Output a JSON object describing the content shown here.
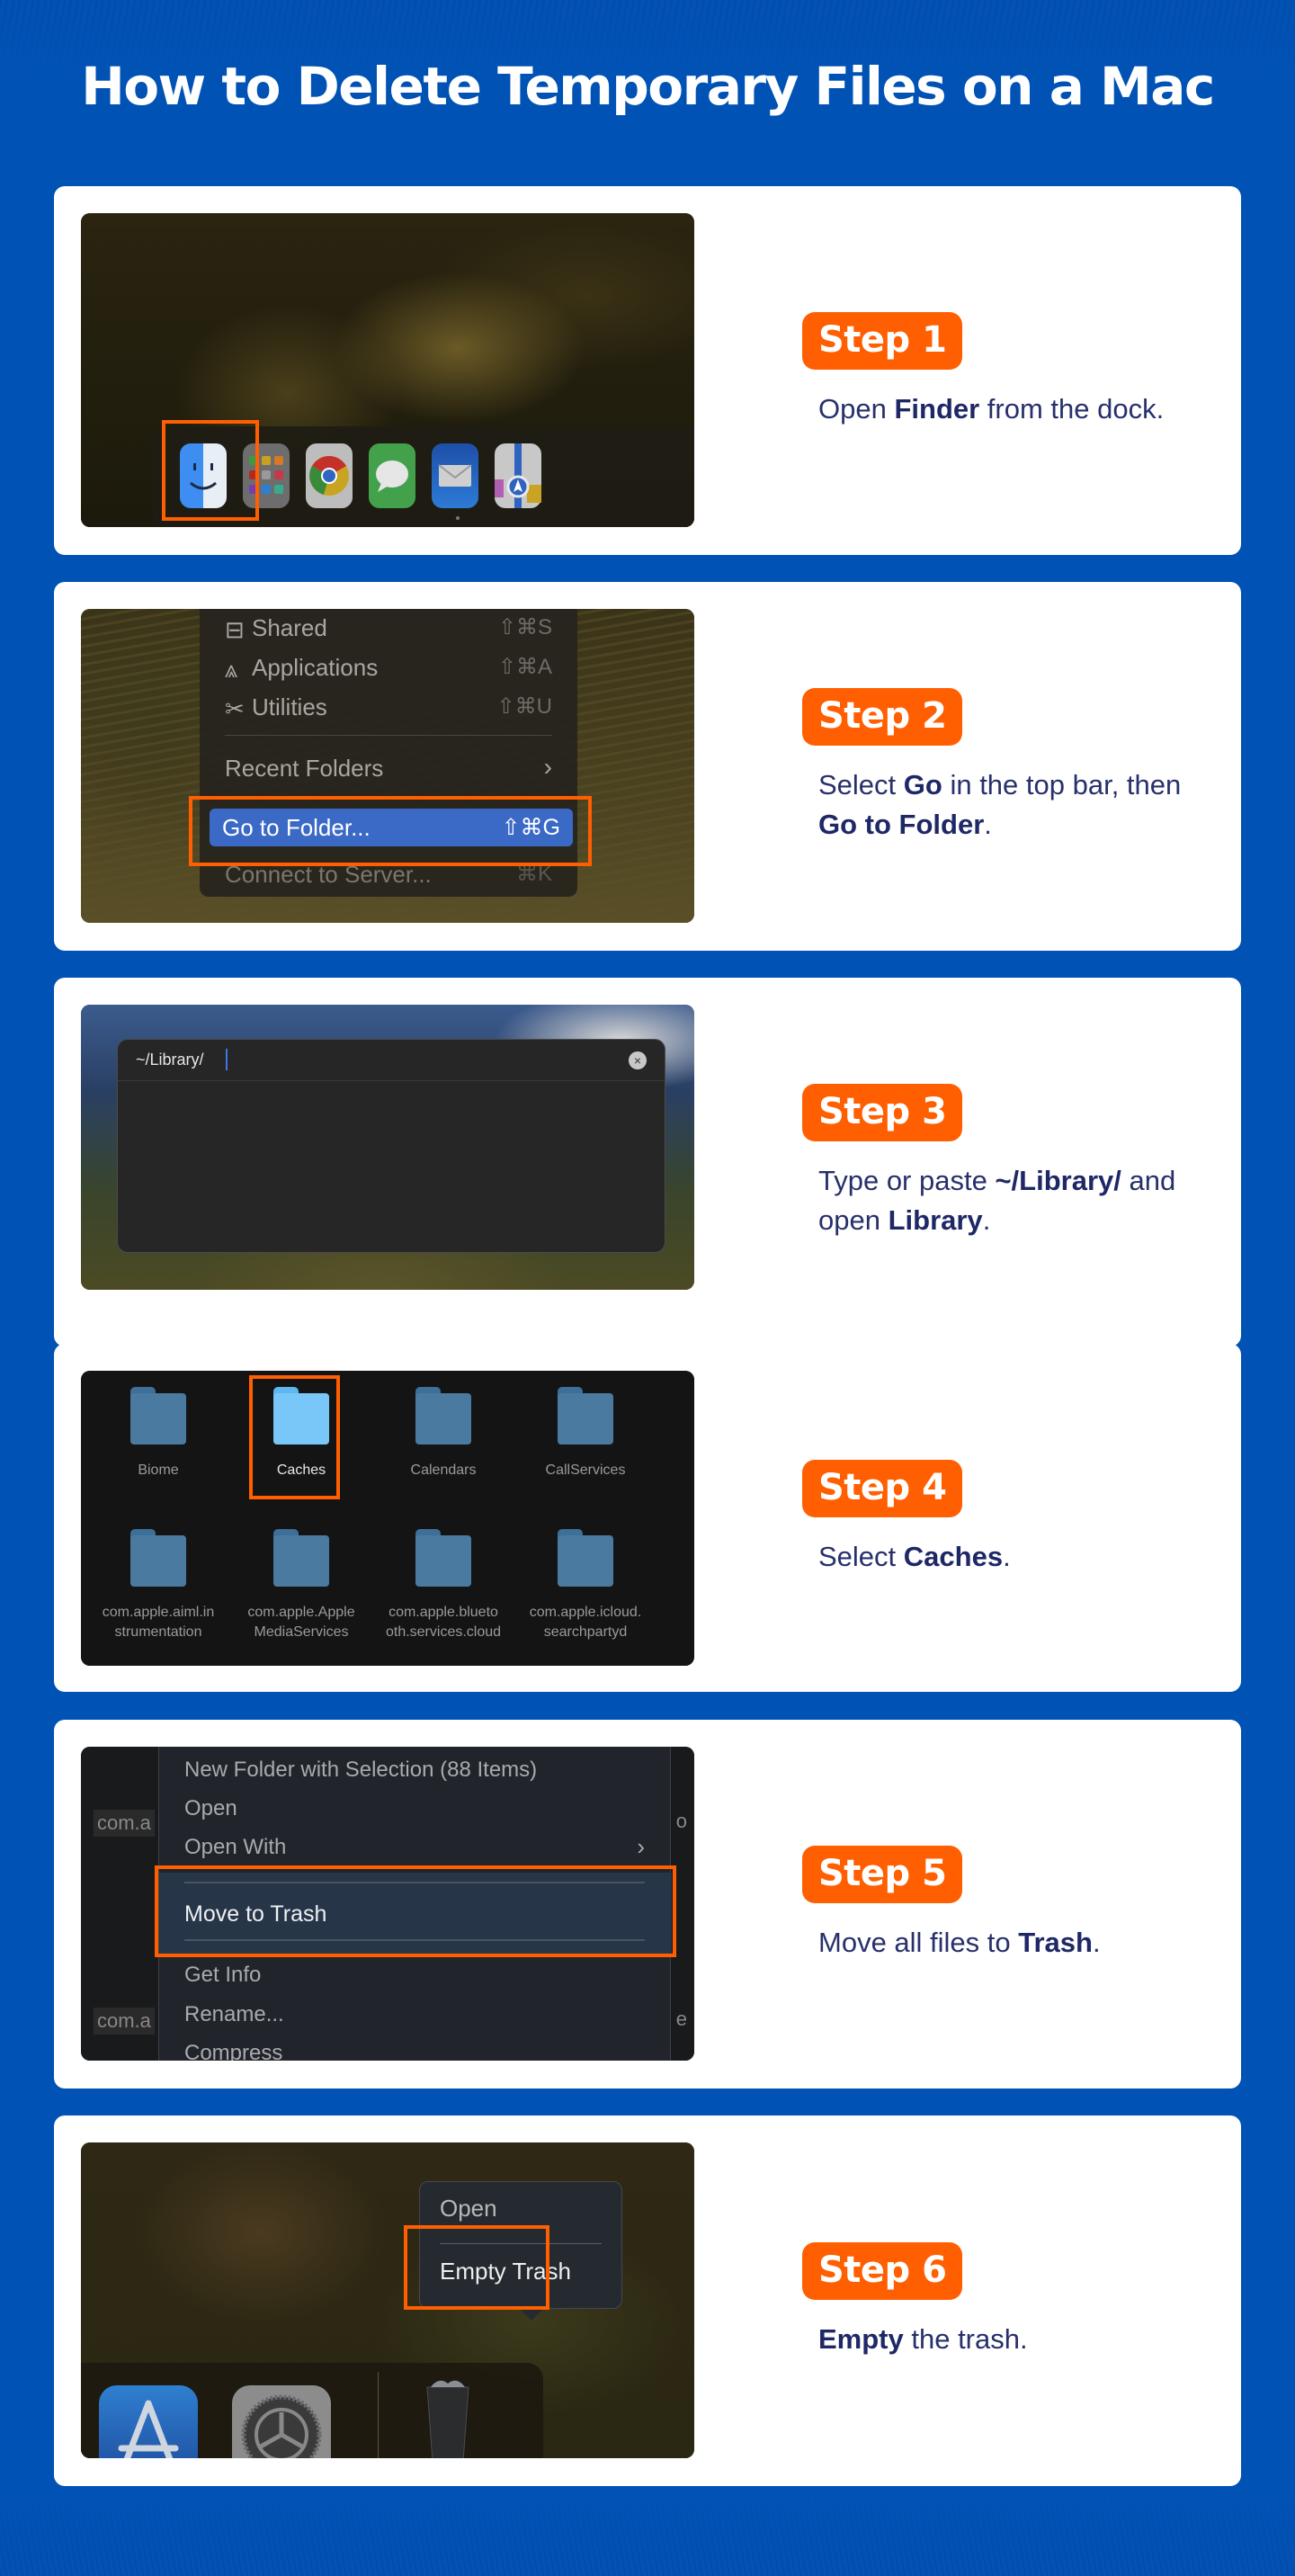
{
  "page": {
    "title": "How to Delete Temporary Files on a Mac",
    "colors": {
      "background": "#0052b4",
      "badge": "#ff5f00",
      "text": "#27306b",
      "highlight": "#ff5f00"
    }
  },
  "steps": [
    {
      "badge": "Step 1",
      "description": [
        {
          "text": "Open ",
          "bold": false
        },
        {
          "text": "Finder",
          "bold": true
        },
        {
          "text": " from the dock.",
          "bold": false
        }
      ],
      "screenshot": {
        "type": "dock",
        "icons": [
          "finder-icon",
          "launchpad-icon",
          "chrome-icon",
          "messages-icon",
          "mail-icon",
          "maps-icon"
        ],
        "highlighted": "finder-icon"
      }
    },
    {
      "badge": "Step 2",
      "description": [
        {
          "text": "Select ",
          "bold": false
        },
        {
          "text": "Go",
          "bold": true
        },
        {
          "text": " in the top bar, then ",
          "bold": false
        },
        {
          "text": "Go to Folder",
          "bold": true
        },
        {
          "text": ".",
          "bold": false
        }
      ],
      "screenshot": {
        "type": "menu",
        "items": [
          {
            "label": "Shared",
            "shortcut": "⇧⌘S",
            "icon": "shared-folder-icon"
          },
          {
            "label": "Applications",
            "shortcut": "⇧⌘A",
            "icon": "applications-icon"
          },
          {
            "label": "Utilities",
            "shortcut": "⇧⌘U",
            "icon": "utilities-icon"
          },
          {
            "label": "Recent Folders",
            "shortcut": "›"
          },
          {
            "label": "Go to Folder...",
            "shortcut": "⇧⌘G",
            "selected": true
          },
          {
            "label": "Connect to Server...",
            "shortcut": "⌘K"
          }
        ]
      }
    },
    {
      "badge": "Step 3",
      "description": [
        {
          "text": "Type or paste ",
          "bold": false
        },
        {
          "text": "~/Library/",
          "bold": true
        },
        {
          "text": " and open ",
          "bold": false
        },
        {
          "text": "Library",
          "bold": true
        },
        {
          "text": ".",
          "bold": false
        }
      ],
      "screenshot": {
        "type": "go-to-folder-dialog",
        "input_value": "~/Library/"
      }
    },
    {
      "badge": "Step 4",
      "description": [
        {
          "text": "Select ",
          "bold": false
        },
        {
          "text": "Caches",
          "bold": true
        },
        {
          "text": ".",
          "bold": false
        }
      ],
      "screenshot": {
        "type": "folder-grid",
        "folders": [
          {
            "label": "Biome"
          },
          {
            "label": "Caches",
            "selected": true
          },
          {
            "label": "Calendars"
          },
          {
            "label": "CallServices"
          },
          {
            "label": "com.apple.aiml.in strumentation"
          },
          {
            "label": "com.apple.Apple MediaServices"
          },
          {
            "label": "com.apple.blueto oth.services.cloud"
          },
          {
            "label": "com.apple.icloud. searchpartyd"
          }
        ]
      }
    },
    {
      "badge": "Step 5",
      "description": [
        {
          "text": "Move all files to ",
          "bold": false
        },
        {
          "text": "Trash",
          "bold": true
        },
        {
          "text": ".",
          "bold": false
        }
      ],
      "screenshot": {
        "type": "context-menu",
        "items": [
          {
            "label": "New Folder with Selection (88 Items)"
          },
          {
            "label": "Open"
          },
          {
            "label": "Open With",
            "submenu": "›"
          },
          {
            "label": "Move to Trash",
            "selected": true
          },
          {
            "label": "Get Info"
          },
          {
            "label": "Rename..."
          },
          {
            "label": "Compress"
          }
        ],
        "background_labels": [
          "com.a",
          "o",
          "com.a",
          "e"
        ]
      }
    },
    {
      "badge": "Step 6",
      "description": [
        {
          "text": "Empty",
          "bold": true
        },
        {
          "text": " the trash.",
          "bold": false
        }
      ],
      "screenshot": {
        "type": "trash-popup",
        "items": [
          {
            "label": "Open"
          },
          {
            "label": "Empty Trash",
            "selected": true
          }
        ],
        "dock_icons": [
          "app-store-icon",
          "system-settings-icon",
          "trash-icon"
        ]
      }
    }
  ]
}
